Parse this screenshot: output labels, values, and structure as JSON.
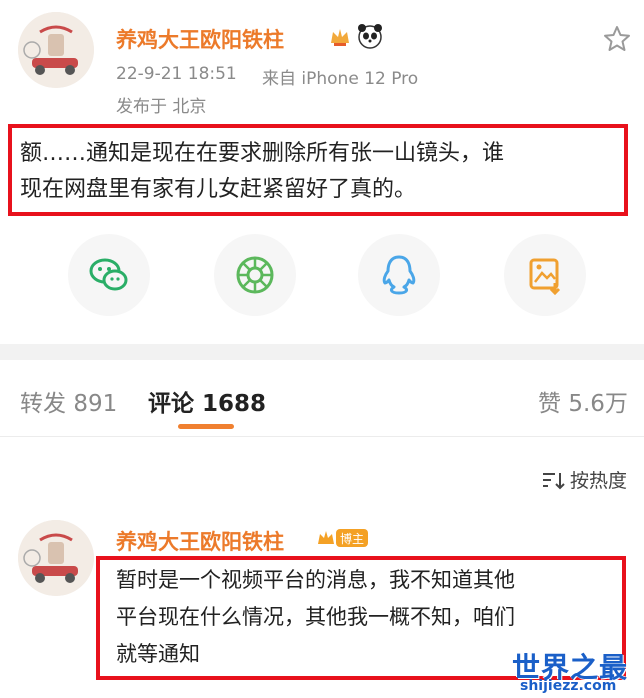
{
  "post": {
    "author": "养鸡大王欧阳铁柱",
    "time": "22-9-21 18:51",
    "source": "来自 iPhone 12 Pro",
    "location": "发布于 北京",
    "text_line1": "额……通知是现在在要求删除所有张一山镜头，谁",
    "text_line2": "现在网盘里有家有儿女赶紧留好了真的。"
  },
  "share": {
    "icons": [
      "wechat-icon",
      "moments-icon",
      "qq-icon",
      "save-image-icon"
    ],
    "colors": {
      "wechat": "#2aae67",
      "moments": "#5cb85c",
      "qq": "#4aa6e8",
      "save": "#f0a030"
    }
  },
  "tabs": {
    "repost_label": "转发",
    "repost_count": "891",
    "comment_label": "评论",
    "comment_count": "1688",
    "like_label": "赞",
    "like_count": "5.6万"
  },
  "sort": {
    "label": "按热度"
  },
  "comment": {
    "author": "养鸡大王欧阳铁柱",
    "badge": "博主",
    "line1": "暂时是一个视频平台的消息，我不知道其他",
    "line2": "平台现在什么情况，其他我一概不知，咱们",
    "line3": "就等通知"
  },
  "watermark": {
    "title": "世界之最",
    "url": "shijiezz.com"
  },
  "colors": {
    "accent": "#ec7a2a",
    "highlight_box": "#e8111c",
    "tab_underline": "#f08030"
  }
}
